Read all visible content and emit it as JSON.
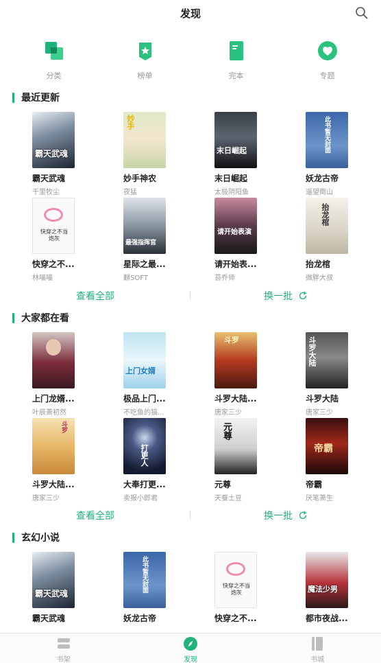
{
  "header": {
    "title": "发现"
  },
  "categories": [
    {
      "label": "分类",
      "icon": "category-squares-icon"
    },
    {
      "label": "榜单",
      "icon": "ranking-badge-icon"
    },
    {
      "label": "完本",
      "icon": "completed-book-icon"
    },
    {
      "label": "专题",
      "icon": "topic-heart-icon"
    }
  ],
  "sections": [
    {
      "title": "最近更新",
      "books": [
        {
          "title": "霸天武魂",
          "author": "千里牧尘",
          "cover_text": "霸天武魂"
        },
        {
          "title": "妙手神农",
          "author": "夜猛",
          "cover_text": "妙手"
        },
        {
          "title": "末日崛起",
          "author": "太极阴阳鱼",
          "cover_text": "末日崛起"
        },
        {
          "title": "妖龙古帝",
          "author": "遥望南山",
          "cover_text": "此书暂无封面"
        },
        {
          "title": "快穿之不...",
          "author": "林喵喵",
          "cover_text": "快穿之不当炮灰"
        },
        {
          "title": "星际之最...",
          "author": "麒SOFT",
          "cover_text": "最强指挥官"
        },
        {
          "title": "请开始表...",
          "author": "苔乔师",
          "cover_text": "请开始表演"
        },
        {
          "title": "抬龙棺",
          "author": "微胖大叔",
          "cover_text": "抬龙棺"
        }
      ],
      "view_all": "查看全部",
      "refresh": "换一批"
    },
    {
      "title": "大家都在看",
      "books": [
        {
          "title": "上门龙婿...",
          "author": "叶辰萧初然",
          "cover_text": ""
        },
        {
          "title": "极品上门...",
          "author": "不吃鱼的猫...",
          "cover_text": "上门女婿"
        },
        {
          "title": "斗罗大陆...",
          "author": "唐家三少",
          "cover_text": "斗罗"
        },
        {
          "title": "斗罗大陆",
          "author": "唐家三少",
          "cover_text": "斗罗大陆"
        },
        {
          "title": "斗罗大陆...",
          "author": "唐家三少",
          "cover_text": "斗罗"
        },
        {
          "title": "大奉打更...",
          "author": "卖报小郎君",
          "cover_text": "打更人"
        },
        {
          "title": "元尊",
          "author": "天蚕土豆",
          "cover_text": "元尊"
        },
        {
          "title": "帝霸",
          "author": "厌笔萧生",
          "cover_text": "帝霸"
        }
      ],
      "view_all": "查看全部",
      "refresh": "换一批"
    },
    {
      "title": "玄幻小说",
      "books": [
        {
          "title": "霸天武魂",
          "author": "",
          "cover_text": "霸天武魂"
        },
        {
          "title": "妖龙古帝",
          "author": "",
          "cover_text": "此书暂无封面"
        },
        {
          "title": "快穿之不...",
          "author": "",
          "cover_text": "快穿之不当炮灰"
        },
        {
          "title": "都市夜战...",
          "author": "",
          "cover_text": "魔法少男"
        }
      ]
    }
  ],
  "tabbar": [
    {
      "label": "书架",
      "icon": "bookshelf-icon",
      "active": false
    },
    {
      "label": "发现",
      "icon": "compass-icon",
      "active": true
    },
    {
      "label": "书城",
      "icon": "bookstore-icon",
      "active": false
    }
  ],
  "colors": {
    "accent": "#1fb37a",
    "muted": "#999999"
  }
}
